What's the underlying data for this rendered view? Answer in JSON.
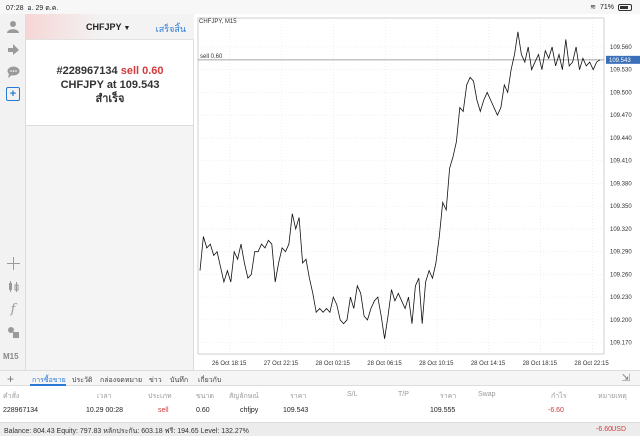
{
  "status_bar": {
    "time": "07:28",
    "date": "อ. 29 ต.ค.",
    "battery": "71%"
  },
  "toolbar": {
    "icons": [
      "account-icon",
      "trade-icon",
      "chat-icon",
      "new-order-icon",
      "crosshair-icon",
      "candles-icon",
      "indicator-icon",
      "objects-icon"
    ],
    "timeframe": "M15"
  },
  "order_panel": {
    "symbol": "CHFJPY",
    "done_label": "เสร็จสิ้น",
    "result": {
      "ticket": "#228967134",
      "side": "sell 0.60",
      "line2_prefix": "CHFJPY at",
      "price": "109.543",
      "status": "สำเร็จ"
    }
  },
  "chart": {
    "title": "CHFJPY, M15",
    "order_line_label": "sell 0.60",
    "current_price_label": "109.543"
  },
  "chart_data": {
    "type": "line",
    "title": "CHFJPY, M15",
    "y_ticks": [
      "109.560",
      "109.530",
      "109.500",
      "109.470",
      "109.440",
      "109.410",
      "109.380",
      "109.350",
      "109.320",
      "109.290",
      "109.260",
      "109.230",
      "109.200",
      "109.170"
    ],
    "x_ticks": [
      "26 Oct 18:15",
      "27 Oct 22:15",
      "28 Oct 02:15",
      "28 Oct 06:15",
      "28 Oct 10:15",
      "28 Oct 14:15",
      "28 Oct 18:15",
      "28 Oct 22:15"
    ],
    "ylim": [
      109.155,
      109.585
    ],
    "order_price": 109.543,
    "series": [
      {
        "values": [
          109.265,
          109.31,
          109.295,
          109.3,
          109.285,
          109.29,
          109.27,
          109.25,
          109.265,
          109.25,
          109.29,
          109.28,
          109.3,
          109.275,
          109.255,
          109.26,
          109.29,
          109.29,
          109.3,
          109.295,
          109.305,
          109.3,
          109.25,
          109.275,
          109.295,
          109.29,
          109.3,
          109.34,
          109.32,
          109.335,
          109.275,
          109.28,
          109.255,
          109.235,
          109.21,
          109.215,
          109.21,
          109.215,
          109.21,
          109.23,
          109.22,
          109.2,
          109.195,
          109.2,
          109.23,
          109.215,
          109.245,
          109.235,
          109.205,
          109.2,
          109.215,
          109.225,
          109.23,
          109.205,
          109.175,
          109.205,
          109.24,
          109.225,
          109.235,
          109.225,
          109.215,
          109.23,
          109.195,
          109.245,
          109.255,
          109.195,
          109.25,
          109.265,
          109.255,
          109.275,
          109.31,
          109.355,
          109.345,
          109.4,
          109.415,
          109.435,
          109.48,
          109.475,
          109.51,
          109.52,
          109.515,
          109.49,
          109.475,
          109.49,
          109.5,
          109.49,
          109.48,
          109.47,
          109.48,
          109.51,
          109.5,
          109.53,
          109.55,
          109.58,
          109.55,
          109.54,
          109.56,
          109.53,
          109.54,
          109.55,
          109.53,
          109.555,
          109.545,
          109.56,
          109.535,
          109.55,
          109.53,
          109.57,
          109.535,
          109.54,
          109.56,
          109.53,
          109.545,
          109.535,
          109.54,
          109.53,
          109.54,
          109.543
        ]
      }
    ]
  },
  "bottom_tabs": {
    "tabs": [
      "การซื้อขาย",
      "ประวัติ",
      "กล่องจดหมาย",
      "ข่าว",
      "บันทึก",
      "เกี่ยวกับ"
    ]
  },
  "trade_table": {
    "headers": [
      "คำสั่ง",
      "เวลา",
      "ประเภท",
      "ขนาด",
      "สัญลักษณ์",
      "ราคา",
      "S/L",
      "T/P",
      "ราคา",
      "Swap",
      "กำไร",
      "หมายเหตุ"
    ],
    "row": {
      "order": "228967134",
      "time": "10.29 00:28",
      "type": "sell",
      "size": "0.60",
      "symbol": "chfjpy",
      "price": "109.543",
      "sl": "",
      "tp": "",
      "current_price": "109.555",
      "swap": "",
      "profit": "-6.60",
      "comment": ""
    }
  },
  "balance_bar": {
    "text": "Balance: 804.43 Equity: 797.83 หลักประกัน: 603.18 ฟรี: 194.65 Level: 132.27%",
    "total": "-6.60",
    "currency": "USD"
  },
  "colors": {
    "accent": "#2a7ad5",
    "sell": "#d43a3a"
  }
}
